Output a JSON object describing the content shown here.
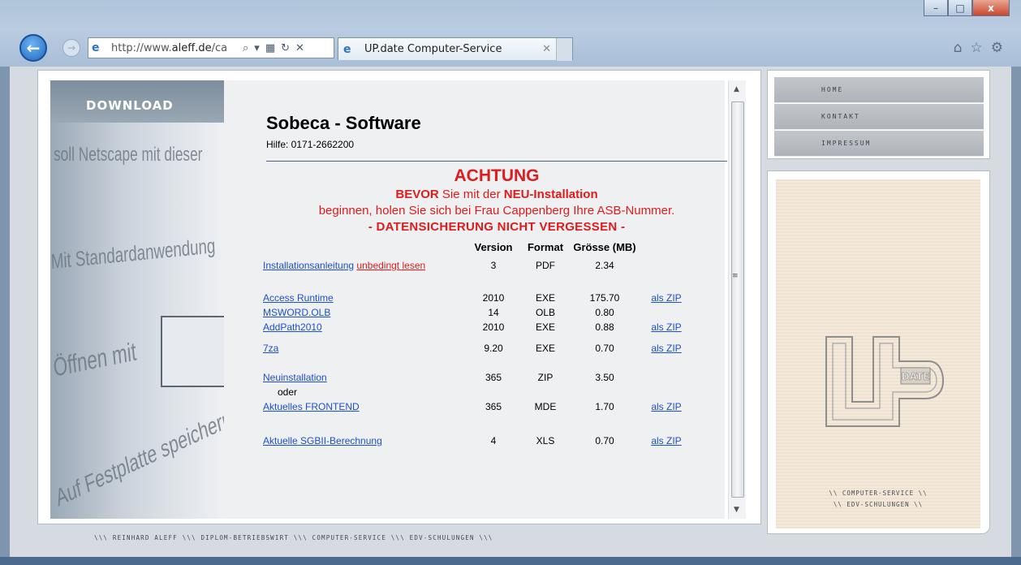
{
  "browser": {
    "address_url_prefix": "http://www.",
    "address_url_domain": "aleff.de",
    "address_url_suffix": "/ca",
    "tab_title": "UP.date Computer-Service",
    "win_minimize": "–",
    "win_maximize": "□",
    "win_close": "x"
  },
  "sidebar_left": {
    "title": "DOWNLOAD",
    "photo_lines": [
      "soll Netscape mit dieser",
      "Mit Standardanwendung",
      "Öffnen mit",
      "Auf Festplatte speichern"
    ]
  },
  "header": {
    "title": "Sobeca - Software",
    "hilfe": "Hilfe: 0171-2662200"
  },
  "warning": {
    "heading": "ACHTUNG",
    "line1_bold1": "BEVOR",
    "line1_mid": " Sie mit der ",
    "line1_bold2": "NEU-Installation",
    "line2": "beginnen, holen Sie sich bei Frau Cappenberg Ihre ASB-Nummer.",
    "line3": "- DATENSICHERUNG NICHT VERGESSEN -"
  },
  "table": {
    "headers": {
      "version": "Version",
      "format": "Format",
      "size": "Grösse (MB)"
    },
    "rows": [
      {
        "name": "Installationsanleitung",
        "extra": "unbedingt lesen",
        "version": "3",
        "format": "PDF",
        "size": "2.34",
        "zip": ""
      },
      {
        "name": "Access Runtime",
        "version": "2010",
        "format": "EXE",
        "size": "175.70",
        "zip": "als ZIP"
      },
      {
        "name": "MSWORD.OLB",
        "version": "14",
        "format": "OLB",
        "size": "0.80",
        "zip": ""
      },
      {
        "name": "AddPath2010",
        "version": "2010",
        "format": "EXE",
        "size": "0.88",
        "zip": "als ZIP"
      },
      {
        "name": "7za",
        "version": "9.20",
        "format": "EXE",
        "size": "0.70",
        "zip": "als ZIP"
      },
      {
        "name": "Neuinstallation",
        "version": "365",
        "format": "ZIP",
        "size": "3.50",
        "zip": ""
      },
      {
        "name": "oder"
      },
      {
        "name": "Aktuelles FRONTEND",
        "version": "365",
        "format": "MDE",
        "size": "1.70",
        "zip": "als ZIP"
      },
      {
        "name": "Aktuelle SGBII-Berechnung",
        "version": "4",
        "format": "XLS",
        "size": "0.70",
        "zip": "als ZIP"
      }
    ]
  },
  "footer": "\\\\\\ REINHARD ALEFF \\\\\\ DIPLOM-BETRIEBSWIRT \\\\\\ COMPUTER-SERVICE \\\\\\ EDV-SCHULUNGEN \\\\\\",
  "nav": {
    "items": [
      "HOME",
      "KONTAKT",
      "IMPRESSUM"
    ]
  },
  "logo": {
    "tag": "DATE",
    "line1": "\\\\ COMPUTER-SERVICE \\\\",
    "line2": "\\\\ EDV-SCHULUNGEN \\\\"
  },
  "colors": {
    "warning_red": "#e01b1b",
    "link_blue": "#1c4fd2"
  }
}
